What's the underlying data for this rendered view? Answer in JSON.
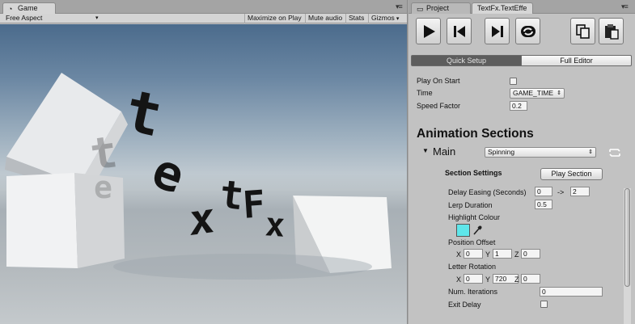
{
  "game_panel": {
    "tab_label": "Game",
    "toolbar": {
      "aspect": "Free Aspect",
      "maximize": "Maximize on Play",
      "mute": "Mute audio",
      "stats": "Stats",
      "gizmos": "Gizmos"
    },
    "scene_letters": [
      "t",
      "e",
      "x",
      "t",
      "F",
      "x"
    ],
    "ghost_letters": [
      "t",
      "e"
    ]
  },
  "inspector": {
    "tabs": {
      "project": "Project",
      "textfx": "TextFx.TextEffe"
    },
    "buttons": [
      "play",
      "step-back",
      "step-forward",
      "loop",
      "copy",
      "paste"
    ],
    "mode_tabs": {
      "quick": "Quick Setup",
      "full": "Full Editor"
    },
    "play_on_start": {
      "label": "Play On Start",
      "checked": false
    },
    "time": {
      "label": "Time",
      "value": "GAME_TIME"
    },
    "speed_factor": {
      "label": "Speed Factor",
      "value": "0.2"
    },
    "animation_sections_title": "Animation Sections",
    "main": {
      "label": "Main",
      "preset": "Spinning"
    },
    "section_settings": {
      "title": "Section Settings",
      "play_button": "Play Section",
      "delay_easing": {
        "label": "Delay Easing (Seconds)",
        "from": "0",
        "arrow": "->",
        "to": "2"
      },
      "lerp_duration": {
        "label": "Lerp Duration",
        "value": "0.5"
      },
      "highlight_colour": {
        "label": "Highlight Colour",
        "color": "#5fe6ea"
      },
      "position_offset": {
        "label": "Position Offset",
        "x": "0",
        "y": "1",
        "z": "0"
      },
      "letter_rotation": {
        "label": "Letter Rotation",
        "x": "0",
        "y": "720",
        "z": "0"
      },
      "iterations": {
        "label": "Num. Iterations",
        "value": "0"
      },
      "exit_delay": {
        "label": "Exit Delay",
        "checked": false
      }
    },
    "axis_labels": {
      "x": "X",
      "y": "Y",
      "z": "Z"
    }
  }
}
